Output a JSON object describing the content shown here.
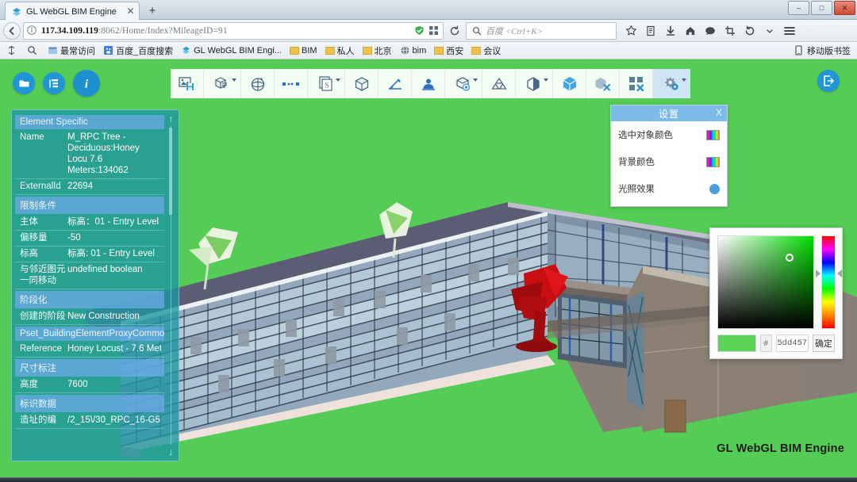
{
  "browser": {
    "tab": {
      "title": "GL WebGL BIM Engine",
      "favicon_icon": "gl-logo-icon",
      "close_icon": "close-icon"
    },
    "new_tab_label": "+",
    "window_controls": {
      "minimize": "–",
      "maximize": "□",
      "close": "✕"
    },
    "nav": {
      "back_icon": "back-arrow-icon",
      "identity_icon": "page-info-icon",
      "url_host": "117.34.109.119",
      "url_rest": ":8062/Home/Index?MileageID=91",
      "full_url": "117.34.109.119:8062/Home/Index?MileageID=91",
      "shield_icon": "shield-icon",
      "extension_icon": "qr-extension-icon",
      "reload_icon": "reload-icon",
      "bookmark_star_icon": "star-icon",
      "reader_icon": "reader-view-icon",
      "downloads_icon": "download-icon",
      "home_icon": "home-icon",
      "sync_icon": "chat-icon",
      "screenshot_icon": "crop-icon",
      "history_back_icon": "history-icon",
      "overflow_icon": "chevron-down-icon",
      "menu_icon": "hamburger-menu-icon"
    },
    "search": {
      "placeholder": "百度 <Ctrl+K>",
      "icon": "search-icon"
    },
    "bookmarks": {
      "items": [
        {
          "label": "",
          "icon": "sync-tabs-icon"
        },
        {
          "label": "",
          "icon": "search-icon"
        },
        {
          "label": "最常访问",
          "icon": "most-visited-icon"
        },
        {
          "label": "百度_百度搜索",
          "icon": "baidu-icon"
        },
        {
          "label": "GL WebGL BIM Engi...",
          "icon": "gl-logo-icon"
        },
        {
          "label": "BIM",
          "icon": "folder-icon"
        },
        {
          "label": "私人",
          "icon": "folder-icon"
        },
        {
          "label": "北京",
          "icon": "folder-icon"
        },
        {
          "label": "bim",
          "icon": "globe-icon"
        },
        {
          "label": "西安",
          "icon": "folder-icon"
        },
        {
          "label": "会议",
          "icon": "folder-icon"
        }
      ],
      "mobile_label": "移动版书签",
      "mobile_icon": "mobile-icon"
    }
  },
  "viewer": {
    "background_color": "#55cc55",
    "watermark": "GL WebGL BIM Engine",
    "left_buttons": [
      {
        "name": "open-folder-button",
        "icon": "folder-icon"
      },
      {
        "name": "model-tree-button",
        "icon": "tree-list-icon"
      },
      {
        "name": "properties-info-button",
        "icon": "info-icon",
        "active": true
      }
    ],
    "right_buttons": [
      {
        "name": "exit-button",
        "icon": "exit-icon"
      }
    ],
    "toolbar": [
      {
        "name": "save-image-tool",
        "icon": "save-image-icon",
        "dropdown": false
      },
      {
        "name": "view-layout-tool",
        "icon": "layout-views-icon",
        "dropdown": true
      },
      {
        "name": "orbit-tool",
        "icon": "orbit-sphere-icon",
        "dropdown": false
      },
      {
        "name": "measure-distance-tool",
        "icon": "distance-dots-icon",
        "dropdown": false
      },
      {
        "name": "section-tool",
        "icon": "s-page-icon",
        "dropdown": true
      },
      {
        "name": "box-tool",
        "icon": "wire-cube-icon",
        "dropdown": false
      },
      {
        "name": "angle-measure-tool",
        "icon": "angle-pencil-icon",
        "dropdown": false
      },
      {
        "name": "walkthrough-tool",
        "icon": "person-walk-icon",
        "dropdown": false
      },
      {
        "name": "visibility-tool",
        "icon": "cube-eye-icon",
        "dropdown": true
      },
      {
        "name": "group-tool",
        "icon": "three-circles-icon",
        "dropdown": false
      },
      {
        "name": "clip-plane-tool",
        "icon": "cut-cube-icon",
        "dropdown": true
      },
      {
        "name": "solid-cube-tool",
        "icon": "solid-cube-icon",
        "dropdown": false
      },
      {
        "name": "hide-element-tool",
        "icon": "cube-x-icon",
        "dropdown": false
      },
      {
        "name": "explode-tool",
        "icon": "explode-blocks-icon",
        "dropdown": false
      },
      {
        "name": "settings-tool",
        "icon": "gear-icon",
        "dropdown": true,
        "selected": true
      }
    ]
  },
  "properties": {
    "scroll_up_icon": "arrow-up-icon",
    "scroll_down_icon": "arrow-down-icon",
    "rows": [
      {
        "type": "header",
        "label": "Element Specific"
      },
      {
        "type": "kv",
        "key": "Name",
        "value": "M_RPC Tree - Deciduous:Honey Locu 7.6 Meters:134062"
      },
      {
        "type": "kv",
        "key": "ExternalId",
        "value": "22694"
      },
      {
        "type": "header",
        "label": "限制条件"
      },
      {
        "type": "kv",
        "key": "主体",
        "value": "标高：01 - Entry Level"
      },
      {
        "type": "kv",
        "key": "偏移量",
        "value": "-50"
      },
      {
        "type": "kv",
        "key": "标高",
        "value": "标高: 01 - Entry Level"
      },
      {
        "type": "kv",
        "key": "与邻近图元一同移动",
        "value": "undefined boolean"
      },
      {
        "type": "header",
        "label": "阶段化"
      },
      {
        "type": "kv",
        "key": "创建的阶段",
        "value": "New Construction"
      },
      {
        "type": "header",
        "label": "Pset_BuildingElementProxyCommo"
      },
      {
        "type": "kv",
        "key": "Reference",
        "value": "Honey Locust - 7.6 Met"
      },
      {
        "type": "header",
        "label": "尺寸标注"
      },
      {
        "type": "kv",
        "key": "高度",
        "value": "7600"
      },
      {
        "type": "header",
        "label": "标识数据"
      },
      {
        "type": "kv",
        "key": "造址的编",
        "value": "/2_15\\/30_RPC_16-G5"
      }
    ]
  },
  "settings_dialog": {
    "title": "设置",
    "close_label": "X",
    "rows": [
      {
        "label": "选中对象颜色",
        "control": "color-swatch",
        "icon": "rainbow-swatch-icon"
      },
      {
        "label": "背景颜色",
        "control": "color-swatch",
        "icon": "rainbow-swatch-icon"
      },
      {
        "label": "光照效果",
        "control": "toggle",
        "icon": "toggle-dot-icon"
      }
    ]
  },
  "color_picker": {
    "hash_symbol": "#",
    "hex_value": "5dd457",
    "confirm_label": "确定",
    "preview_color": "#5dd457",
    "cursor_icon": "picker-cursor-icon",
    "hue_left_icon": "hue-arrow-left-icon",
    "hue_right_icon": "hue-arrow-right-icon"
  }
}
